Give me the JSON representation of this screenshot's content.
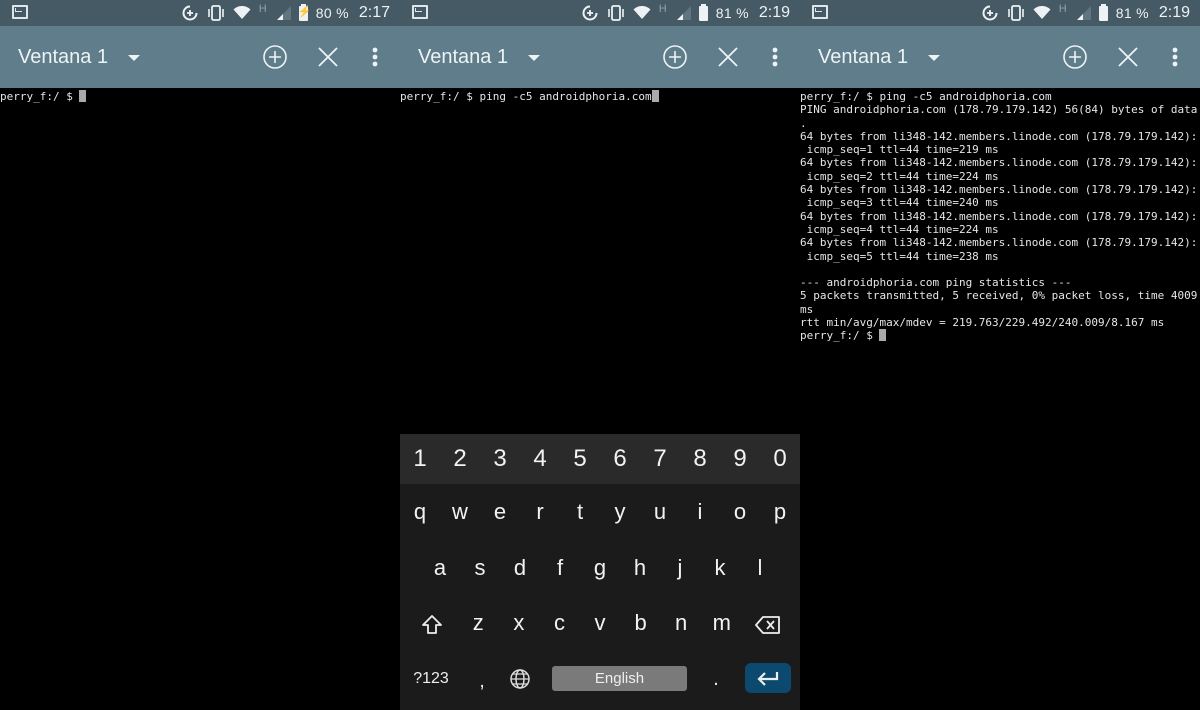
{
  "panels": [
    {
      "status": {
        "battery_pct": "80 %",
        "time": "2:17",
        "charging": true,
        "network_type": "H"
      },
      "toolbar": {
        "title": "Ventana 1"
      },
      "terminal": {
        "lines": [
          "perry_f:/ $ "
        ]
      },
      "keyboard_visible": false
    },
    {
      "status": {
        "battery_pct": "81 %",
        "time": "2:19",
        "charging": false,
        "network_type": "H"
      },
      "toolbar": {
        "title": "Ventana 1"
      },
      "terminal": {
        "lines": [
          "perry_f:/ $ ping -c5 androidphoria.com"
        ]
      },
      "keyboard_visible": true
    },
    {
      "status": {
        "battery_pct": "81 %",
        "time": "2:19",
        "charging": false,
        "network_type": "H"
      },
      "toolbar": {
        "title": "Ventana 1"
      },
      "terminal": {
        "lines": [
          "perry_f:/ $ ping -c5 androidphoria.com",
          "PING androidphoria.com (178.79.179.142) 56(84) bytes of data",
          ".",
          "64 bytes from li348-142.members.linode.com (178.79.179.142):",
          " icmp_seq=1 ttl=44 time=219 ms",
          "64 bytes from li348-142.members.linode.com (178.79.179.142):",
          " icmp_seq=2 ttl=44 time=224 ms",
          "64 bytes from li348-142.members.linode.com (178.79.179.142):",
          " icmp_seq=3 ttl=44 time=240 ms",
          "64 bytes from li348-142.members.linode.com (178.79.179.142):",
          " icmp_seq=4 ttl=44 time=224 ms",
          "64 bytes from li348-142.members.linode.com (178.79.179.142):",
          " icmp_seq=5 ttl=44 time=238 ms",
          "",
          "--- androidphoria.com ping statistics ---",
          "5 packets transmitted, 5 received, 0% packet loss, time 4009",
          "ms",
          "rtt min/avg/max/mdev = 219.763/229.492/240.009/8.167 ms",
          "perry_f:/ $ "
        ]
      },
      "keyboard_visible": false
    }
  ],
  "keyboard": {
    "number_row": [
      "1",
      "2",
      "3",
      "4",
      "5",
      "6",
      "7",
      "8",
      "9",
      "0"
    ],
    "row1": [
      "q",
      "w",
      "e",
      "r",
      "t",
      "y",
      "u",
      "i",
      "o",
      "p"
    ],
    "row2": [
      "a",
      "s",
      "d",
      "f",
      "g",
      "h",
      "j",
      "k",
      "l"
    ],
    "row3": [
      "z",
      "x",
      "c",
      "v",
      "b",
      "n",
      "m"
    ],
    "symbols_label": "?123",
    "comma": ",",
    "period": ".",
    "space_label": "English",
    "icons": {
      "shift": "shift-icon",
      "backspace": "backspace-icon",
      "globe": "globe-icon",
      "enter": "enter-icon"
    }
  },
  "colors": {
    "statusbar": "#455a64",
    "toolbar": "#607d8b",
    "enter_key": "#0b4a6e"
  }
}
